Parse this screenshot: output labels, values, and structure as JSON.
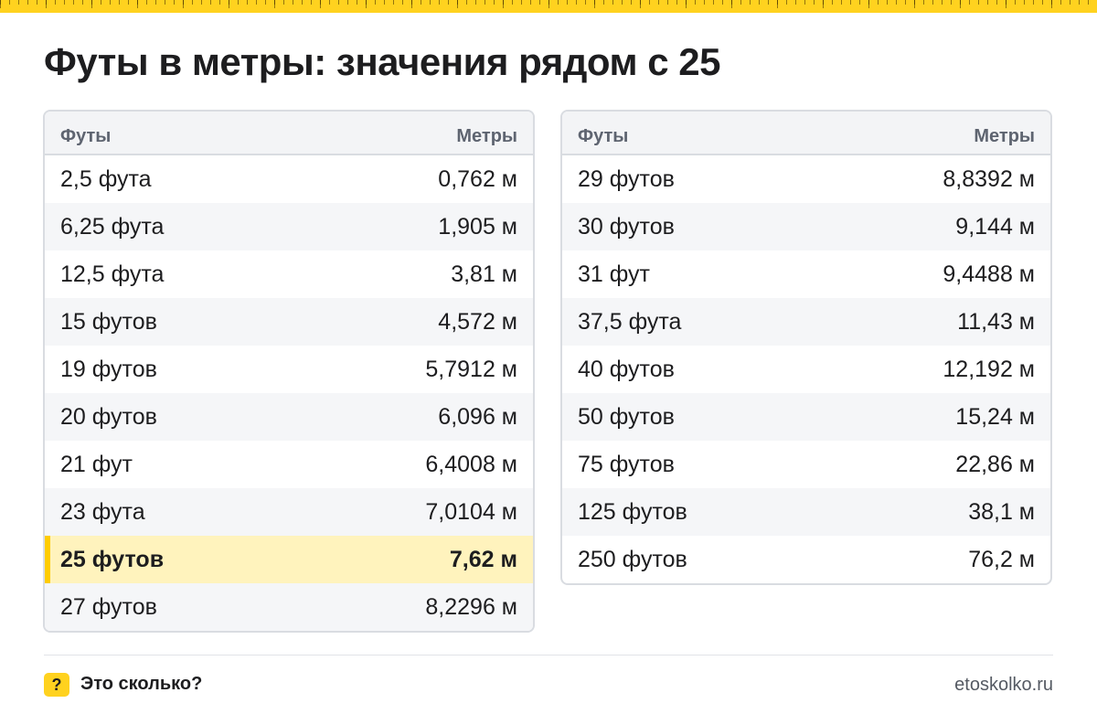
{
  "title": "Футы в метры: значения рядом с 25",
  "colors": {
    "accent": "#ffd21f",
    "highlight": "#fff3bd",
    "border": "#d9dce1"
  },
  "tables": [
    {
      "header": {
        "left": "Футы",
        "right": "Метры"
      },
      "rows": [
        {
          "feet": "2,5 фута",
          "meters": "0,762 м",
          "highlight": false
        },
        {
          "feet": "6,25 фута",
          "meters": "1,905 м",
          "highlight": false
        },
        {
          "feet": "12,5 фута",
          "meters": "3,81 м",
          "highlight": false
        },
        {
          "feet": "15 футов",
          "meters": "4,572 м",
          "highlight": false
        },
        {
          "feet": "19 футов",
          "meters": "5,7912 м",
          "highlight": false
        },
        {
          "feet": "20 футов",
          "meters": "6,096 м",
          "highlight": false
        },
        {
          "feet": "21 фут",
          "meters": "6,4008 м",
          "highlight": false
        },
        {
          "feet": "23 фута",
          "meters": "7,0104 м",
          "highlight": false
        },
        {
          "feet": "25 футов",
          "meters": "7,62 м",
          "highlight": true
        },
        {
          "feet": "27 футов",
          "meters": "8,2296 м",
          "highlight": false
        }
      ]
    },
    {
      "header": {
        "left": "Футы",
        "right": "Метры"
      },
      "rows": [
        {
          "feet": "29 футов",
          "meters": "8,8392 м",
          "highlight": false
        },
        {
          "feet": "30 футов",
          "meters": "9,144 м",
          "highlight": false
        },
        {
          "feet": "31 фут",
          "meters": "9,4488 м",
          "highlight": false
        },
        {
          "feet": "37,5 фута",
          "meters": "11,43 м",
          "highlight": false
        },
        {
          "feet": "40 футов",
          "meters": "12,192 м",
          "highlight": false
        },
        {
          "feet": "50 футов",
          "meters": "15,24 м",
          "highlight": false
        },
        {
          "feet": "75 футов",
          "meters": "22,86 м",
          "highlight": false
        },
        {
          "feet": "125 футов",
          "meters": "38,1 м",
          "highlight": false
        },
        {
          "feet": "250 футов",
          "meters": "76,2 м",
          "highlight": false
        }
      ]
    }
  ],
  "footer": {
    "badge_icon": "question-mark-icon",
    "badge_text": "?",
    "brand": "Это сколько?",
    "site": "etoskolko.ru"
  }
}
